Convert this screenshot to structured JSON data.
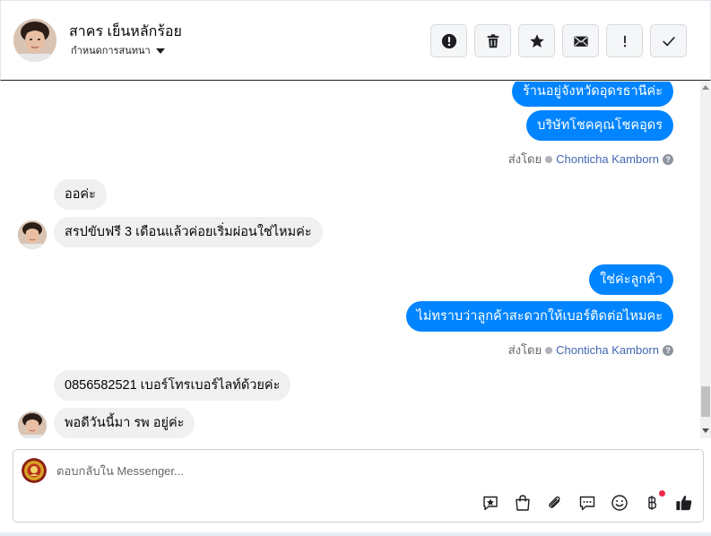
{
  "header": {
    "contact_name": "สาคร เย็นหลักร้อย",
    "assign_label": "กำหนดการสนทนา",
    "tools": [
      {
        "name": "spam-button",
        "icon": "alert-circle-icon"
      },
      {
        "name": "delete-button",
        "icon": "trash-icon"
      },
      {
        "name": "star-button",
        "icon": "star-icon"
      },
      {
        "name": "mark-unread-button",
        "icon": "envelope-icon"
      },
      {
        "name": "follow-up-button",
        "icon": "exclamation-icon"
      },
      {
        "name": "mark-done-button",
        "icon": "check-icon"
      }
    ]
  },
  "thread": {
    "messages": [
      {
        "dir": "out",
        "text": "ร้านอยู่จังหวัดอุดรธานีค่ะ"
      },
      {
        "dir": "out",
        "text": "บริษัทโชคคุณโชคอุดร"
      },
      {
        "dir": "in",
        "text": "ออค่ะ"
      },
      {
        "dir": "in",
        "text": "สรปขับฟรี 3 เดือนแล้วค่อยเริ่มผ่อนใช่ไหมค่ะ"
      },
      {
        "dir": "out",
        "text": "ใช่ค่ะลูกค้า"
      },
      {
        "dir": "out",
        "text": "ไม่ทราบว่าลูกค้าสะดวกให้เบอร์ติดต่อไหมคะ"
      },
      {
        "dir": "in",
        "text": "0856582521 เบอร์โทรเบอร์ไลท์ด้วยค่ะ"
      },
      {
        "dir": "in",
        "text": "พอดีวันนี้มา รพ อยู่ค่ะ"
      }
    ],
    "sent_by_label": "ส่งโดย",
    "agent_name": "Chonticha Kamborn"
  },
  "composer": {
    "placeholder": "ตอบกลับใน Messenger...",
    "actions": [
      "saved-reply-icon",
      "shopping-bag-icon",
      "paperclip-icon",
      "chat-bubble-icon",
      "emoji-icon",
      "baht-icon",
      "thumbs-up-icon"
    ]
  },
  "colors": {
    "outgoing_bubble": "#0084ff",
    "incoming_bubble": "#f0f0f0",
    "agent_link": "#4267b2",
    "notification_dot": "#f02849"
  }
}
